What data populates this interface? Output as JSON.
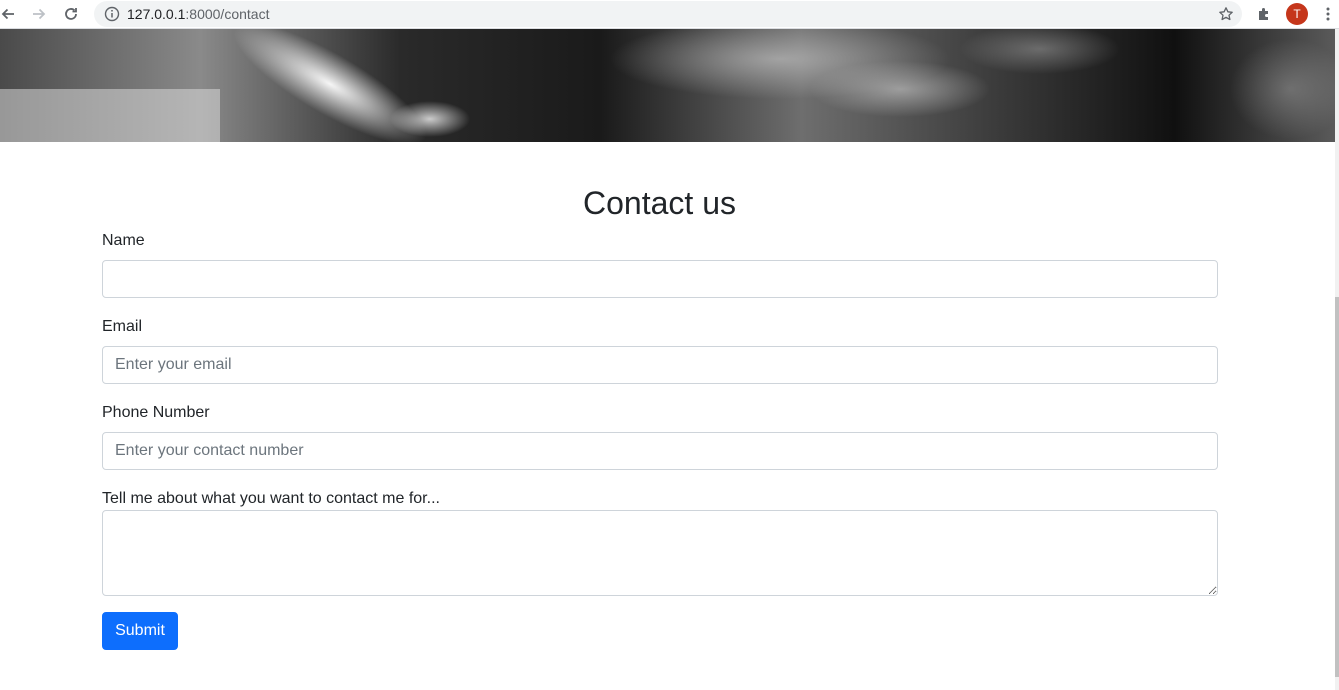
{
  "browser": {
    "url_host": "127.0.0.1",
    "url_path": ":8000/contact",
    "avatar_letter": "T",
    "avatar_color": "#c5361b"
  },
  "page": {
    "title": "Contact us",
    "accent_color": "#0d6efd"
  },
  "form": {
    "name_label": "Name",
    "name_value": "",
    "email_label": "Email",
    "email_placeholder": "Enter your email",
    "phone_label": "Phone Number",
    "phone_placeholder": "Enter your contact number",
    "message_label": "Tell me about what you want to contact me for...",
    "message_value": "",
    "submit_label": "Submit"
  }
}
